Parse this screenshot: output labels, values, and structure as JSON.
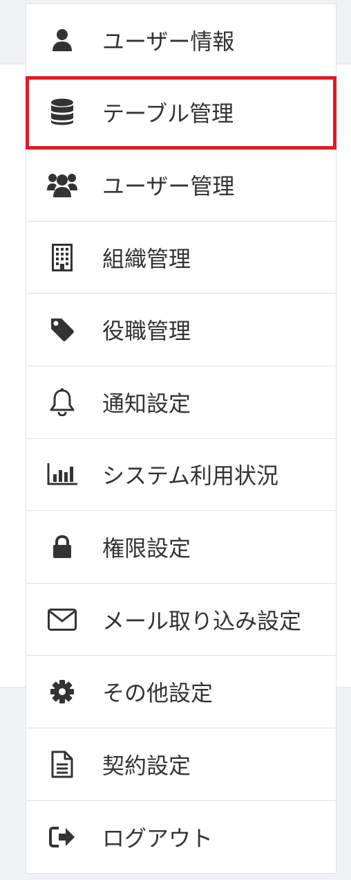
{
  "menu": {
    "items": [
      {
        "label": "ユーザー情報",
        "icon": "user-icon"
      },
      {
        "label": "テーブル管理",
        "icon": "database-icon",
        "selected": true
      },
      {
        "label": "ユーザー管理",
        "icon": "users-icon"
      },
      {
        "label": "組織管理",
        "icon": "building-icon"
      },
      {
        "label": "役職管理",
        "icon": "tag-icon"
      },
      {
        "label": "通知設定",
        "icon": "bell-icon"
      },
      {
        "label": "システム利用状況",
        "icon": "bar-chart-icon"
      },
      {
        "label": "権限設定",
        "icon": "lock-icon"
      },
      {
        "label": "メール取り込み設定",
        "icon": "envelope-icon"
      },
      {
        "label": "その他設定",
        "icon": "gear-icon"
      },
      {
        "label": "契約設定",
        "icon": "document-icon"
      },
      {
        "label": "ログアウト",
        "icon": "sign-out-icon"
      }
    ]
  },
  "colors": {
    "highlight": "#e11a24",
    "icon": "#333333",
    "text": "#333333"
  }
}
